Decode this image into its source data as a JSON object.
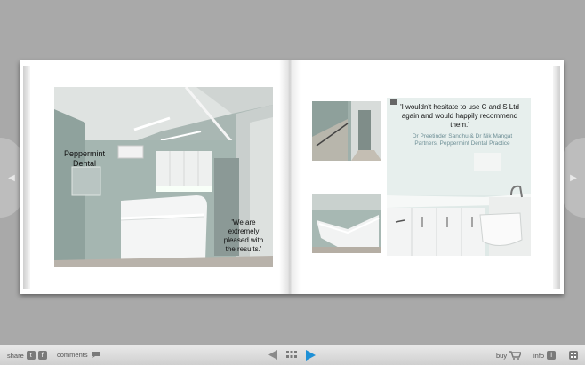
{
  "nav": {
    "prev_icon": "chevron-left-icon",
    "next_icon": "chevron-right-icon"
  },
  "left_page": {
    "photo_label": "Peppermint\nDental",
    "quote": "'We are\nextremely\npleased with\nthe results.'"
  },
  "right_page": {
    "quote": "'I wouldn't hesitate to use C and S Ltd\nagain and would happily recommend\nthem.'",
    "attribution": "Dr Preetinder Sandhu & Dr Nik Mangat\nPartners, Peppermint Dental Practice"
  },
  "toolbar": {
    "share_label": "share",
    "comments_label": "comments",
    "buy_label": "buy",
    "info_label": "info",
    "twitter_glyph": "t",
    "facebook_glyph": "f",
    "info_glyph": "i"
  },
  "colors": {
    "background": "#a9a9a9",
    "play_accent": "#1e90d6"
  }
}
